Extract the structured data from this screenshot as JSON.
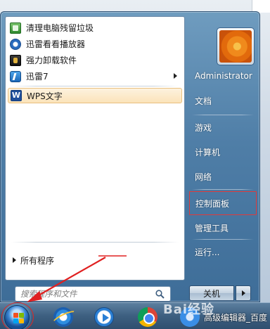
{
  "start_menu": {
    "programs": [
      {
        "label": "清理电脑残留垃圾",
        "icon": "cleaner-icon",
        "has_submenu": false
      },
      {
        "label": "迅雷看看播放器",
        "icon": "media-player-icon",
        "has_submenu": false
      },
      {
        "label": "强力卸载软件",
        "icon": "uninstall-icon",
        "has_submenu": false
      },
      {
        "label": "迅雷7",
        "icon": "xunlei-icon",
        "has_submenu": true
      },
      {
        "label": "WPS文字",
        "icon": "wps-icon",
        "has_submenu": false,
        "selected": true
      }
    ],
    "all_programs_label": "所有程序",
    "search_placeholder": "搜索程序和文件",
    "user_name": "Administrator",
    "right_items": [
      {
        "label": "文档"
      },
      {
        "label": "游戏"
      },
      {
        "label": "计算机"
      },
      {
        "label": "网络"
      },
      {
        "label": "控制面板",
        "highlighted": true
      },
      {
        "label": "管理工具"
      },
      {
        "label": "运行..."
      }
    ],
    "shutdown_label": "关机"
  },
  "taskbar": {
    "pinned": [
      "start-orb-icon",
      "internet-explorer-icon",
      "media-player-icon",
      "chrome-icon",
      "baidu-icon"
    ],
    "window_title": "高级编辑器_百度",
    "watermark": "Bai经验"
  },
  "colors": {
    "highlight_border": "#e03a3a",
    "annotation_arrow": "#e02020",
    "selected_item_bg": "#fbe3b9"
  }
}
